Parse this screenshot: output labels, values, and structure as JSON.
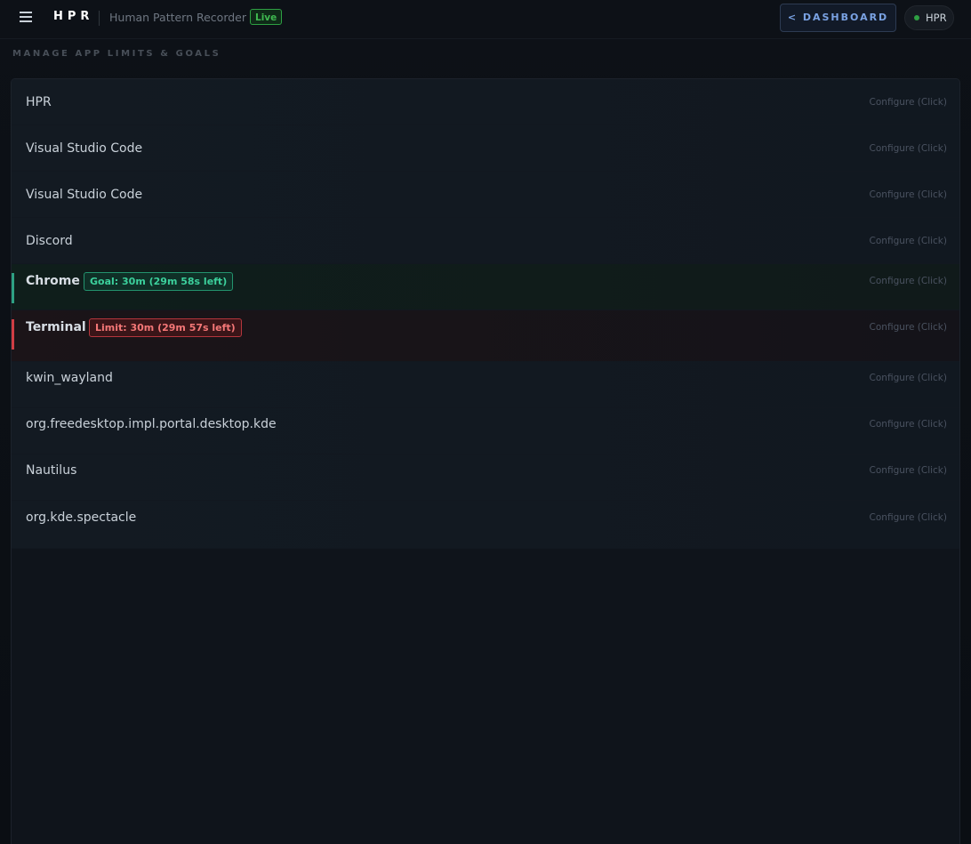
{
  "header": {
    "brand": "HPR",
    "subtitle": "Human Pattern Recorder",
    "live_badge": "Live",
    "dashboard_button": "< DASHBOARD",
    "user_label": "HPR",
    "icons": {
      "menu": "hamburger-menu-icon",
      "status": "status-dot-icon"
    }
  },
  "section_title": "MANAGE APP LIMITS & GOALS",
  "apps": [
    {
      "name": "HPR",
      "configure": "Configure (Click)"
    },
    {
      "name": "Visual Studio Code",
      "configure": "Configure (Click)"
    },
    {
      "name": "Visual Studio Code",
      "configure": "Configure (Click)"
    },
    {
      "name": "Discord",
      "configure": "Configure (Click)"
    },
    {
      "name": "Chrome",
      "configure": "Configure (Click)",
      "tag": "Goal: 30m (29m 58s left)",
      "tag_type": "goal"
    },
    {
      "name": "Terminal",
      "configure": "Configure (Click)",
      "tag": "Limit: 30m (29m 57s left)",
      "tag_type": "limit"
    },
    {
      "name": "kwin_wayland",
      "configure": "Configure (Click)"
    },
    {
      "name": "org.freedesktop.impl.portal.desktop.kde",
      "configure": "Configure (Click)"
    },
    {
      "name": "Nautilus",
      "configure": "Configure (Click)"
    },
    {
      "name": "org.kde.spectacle",
      "configure": "Configure (Click)"
    }
  ],
  "colors": {
    "background": "#0d1117",
    "goal_accent": "#2ea083",
    "limit_accent": "#d03d44",
    "live_green": "#3fb950",
    "dashboard_blue": "#7aa2e3"
  }
}
